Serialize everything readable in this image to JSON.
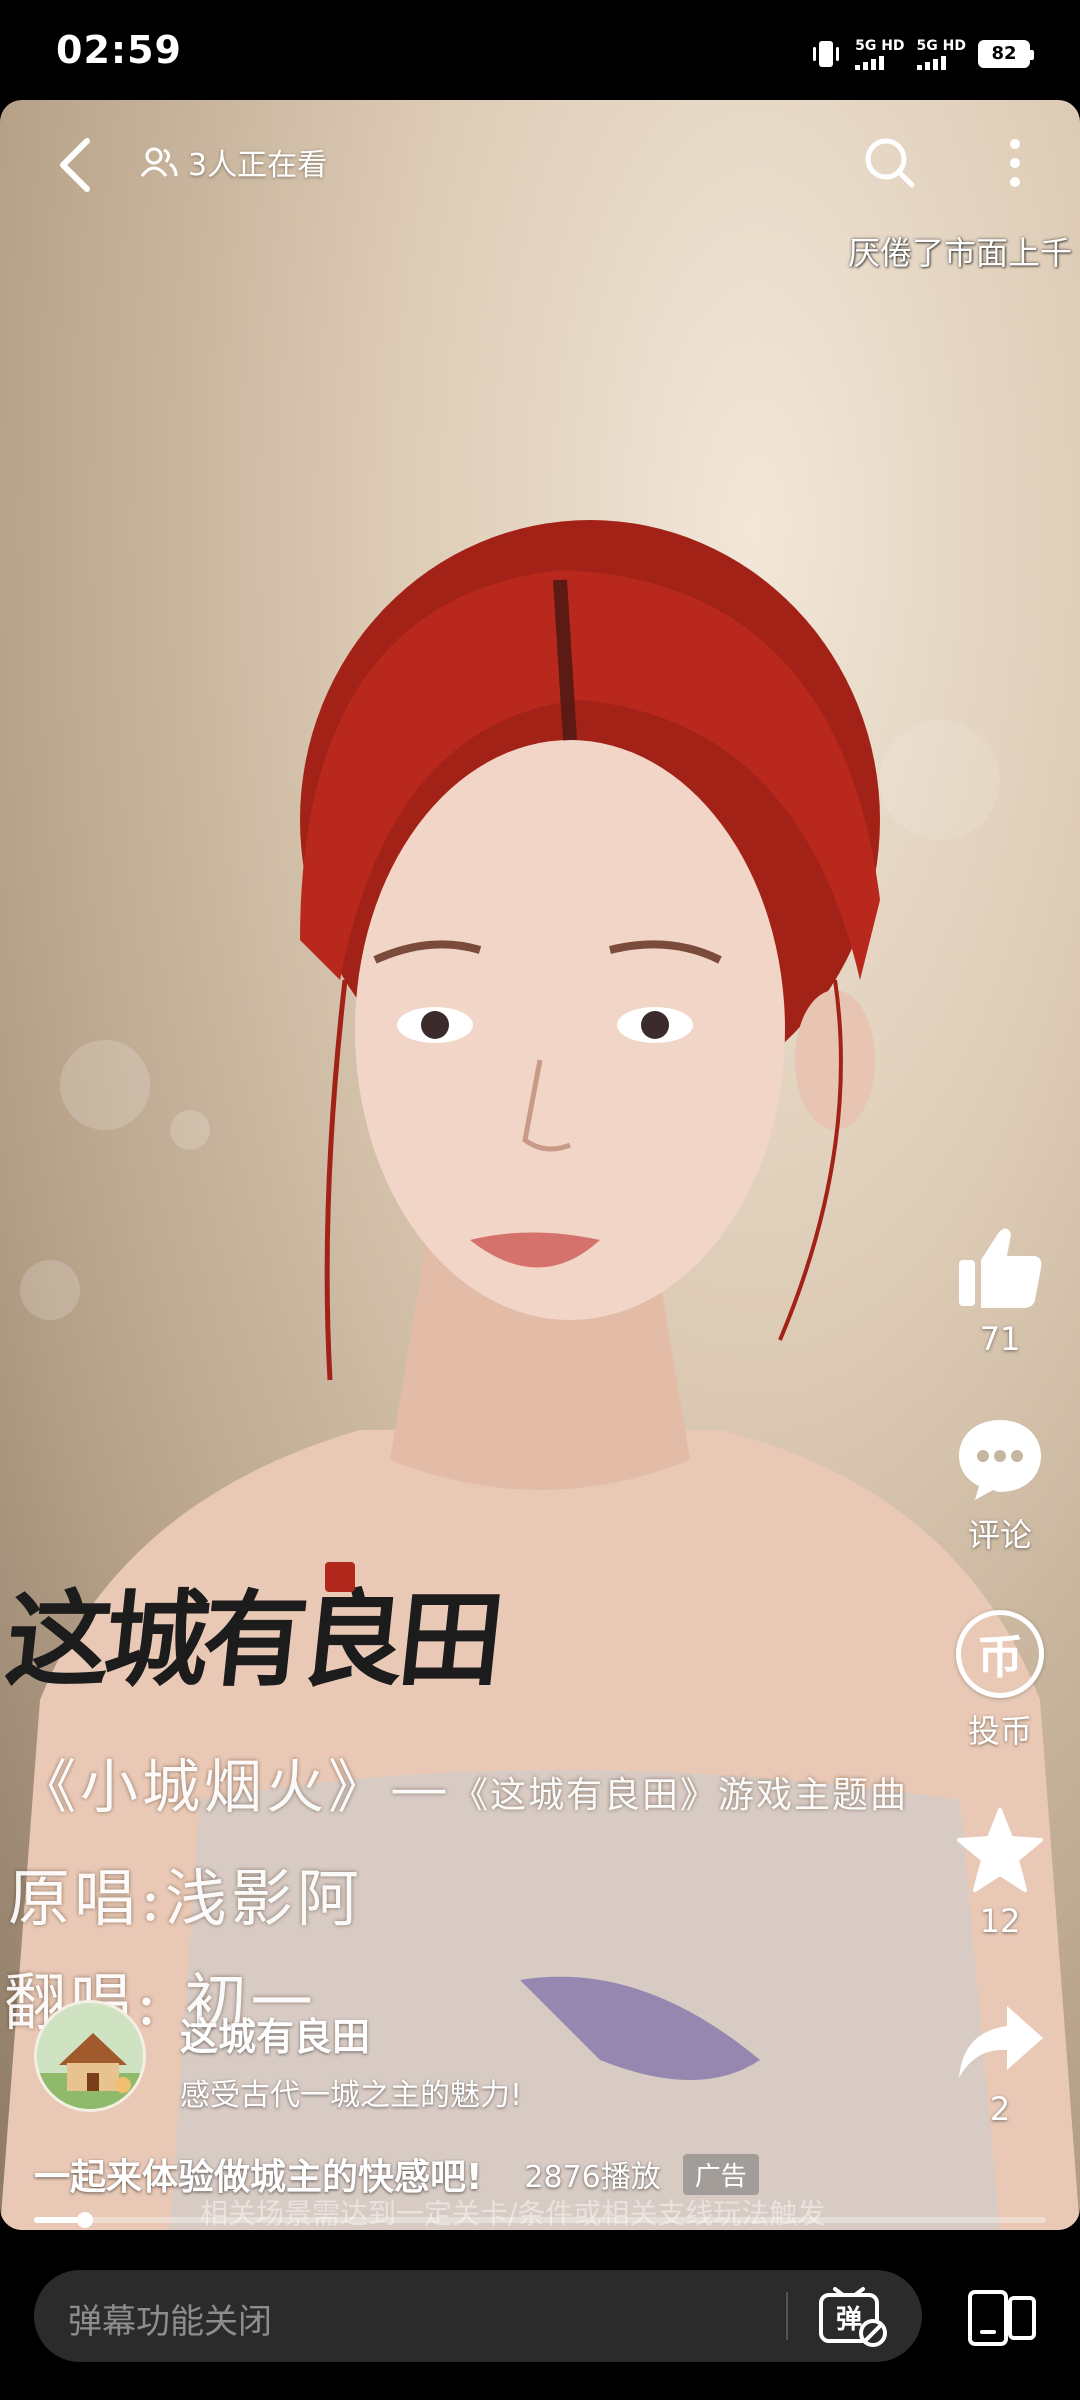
{
  "status_bar": {
    "time": "02:59",
    "network_1": "5G HD",
    "network_2": "5G HD",
    "battery": "82"
  },
  "header": {
    "viewers": "3人正在看"
  },
  "danmaku_text": "厌倦了市面上千",
  "video_overlay": {
    "game_logo": "这城有良田",
    "lyric_line_1": "《小城烟火》—",
    "lyric_line_1_small": "《这城有良田》游戏主题曲",
    "lyric_line_2": "原唱:浅影阿",
    "lyric_line_3": "翻唱: 初一"
  },
  "actions": {
    "like_count": "71",
    "comment_label": "评论",
    "coin_symbol": "币",
    "coin_label": "投币",
    "favorite_count": "12",
    "share_count": "2"
  },
  "uploader": {
    "name": "这城有良田",
    "description": "感受古代一城之主的魅力!"
  },
  "video": {
    "title": "一起来体验做城主的快感吧!",
    "play_count": "2876播放",
    "ad_label": "广告",
    "sub_caption": "相关场景需达到一定关卡/条件或相关支线玩法触发",
    "progress": 0.05
  },
  "bottom_bar": {
    "danmaku_placeholder": "弹幕功能关闭",
    "danmaku_toggle_glyph": "弹"
  },
  "colors": {
    "background": "#000000",
    "input_background": "#2b2b2b",
    "hair": "#b8281c",
    "logo_seal": "#b2271c"
  }
}
